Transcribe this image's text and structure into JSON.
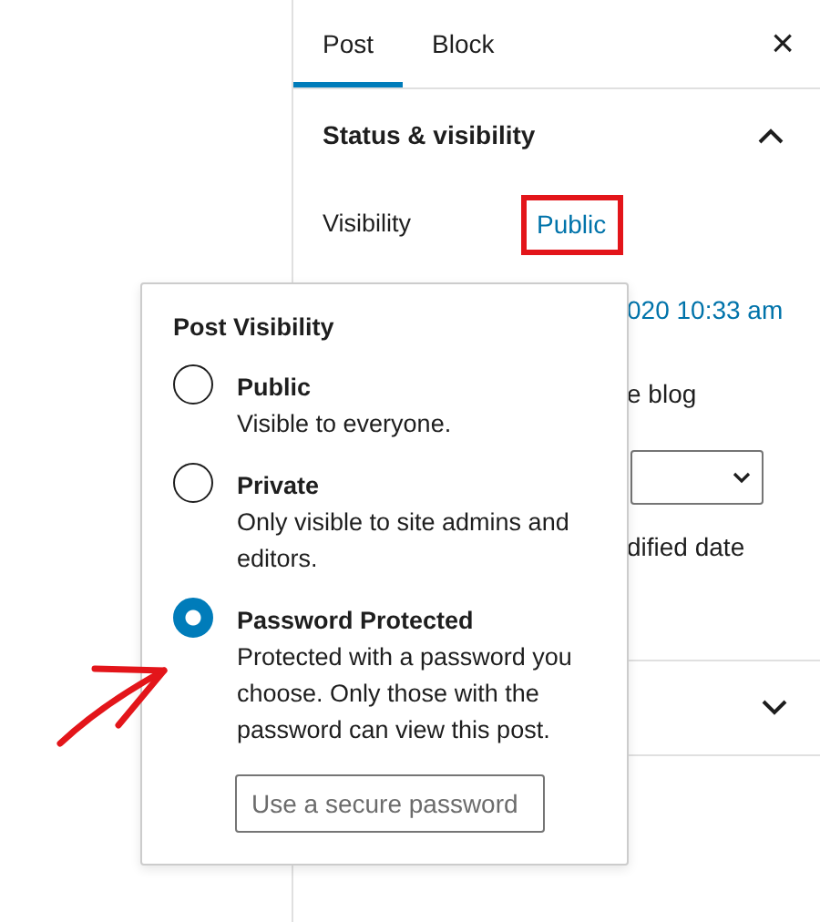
{
  "tabs": [
    {
      "label": "Post",
      "selected": true
    },
    {
      "label": "Block",
      "selected": false
    }
  ],
  "close": "×",
  "panel": {
    "title": "Status & visibility",
    "expanded": true,
    "visibility": {
      "label": "Visibility",
      "value": "Public",
      "highlighted": true
    },
    "date_fragment": "020 10:33 am",
    "sticky_fragment": "e blog",
    "modified_fragment": "dified date"
  },
  "collapsed_panel": {
    "expanded": false
  },
  "popover": {
    "title": "Post Visibility",
    "options": [
      {
        "label": "Public",
        "description": "Visible to everyone.",
        "selected": false
      },
      {
        "label": "Private",
        "description": "Only visible to site admins and editors.",
        "selected": false
      },
      {
        "label": "Password Protected",
        "description": "Protected with a password you choose. Only those with the password can view this post.",
        "selected": true
      }
    ],
    "password": {
      "placeholder": "Use a secure password"
    }
  }
}
